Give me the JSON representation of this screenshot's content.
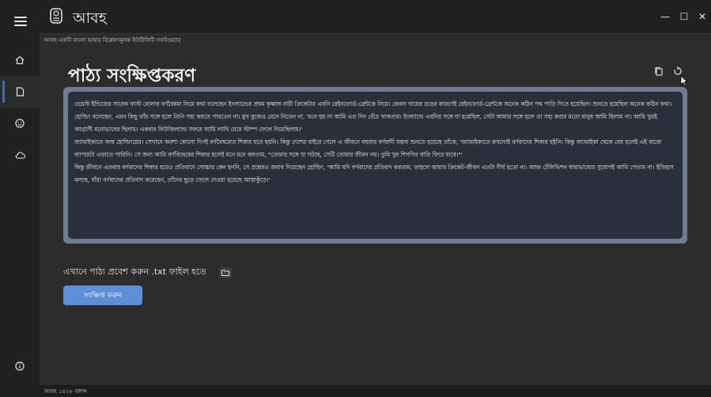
{
  "window": {
    "title": "আবহ",
    "minimize_glyph": "—",
    "maximize_glyph": "☐",
    "close_glyph": "✕"
  },
  "sidebar": {
    "items": [
      {
        "icon": "home-icon"
      },
      {
        "icon": "document-icon",
        "active": true
      },
      {
        "icon": "smile-icon"
      },
      {
        "icon": "cloud-icon"
      },
      {
        "icon": "info-icon"
      }
    ]
  },
  "header": {
    "tagline": "আবহ একটি বাংলা ভাষার বিশ্লেষণমূলক ইউটিলিটি সফটওয়্যার"
  },
  "main": {
    "page_title": "পাঠ্য সংক্ষিপ্তকরণ",
    "text_paragraphs": [
      "ওয়েস্ট ইন্ডিজের সাবেক ফাস্ট বোলার বর্ণবৈষম্য নিয়ে কথা বলেছেন ইংল্যান্ডের প্রথম কৃষ্ণাঙ্গ নারী ক্রিকেটার এবনি রেইনফোর্ড-ব্রেন্টকে নিয়ে। কেবল গায়ের রঙের কারণেই রেইনফোর্ড-ব্রেন্টকে অনেক কঠিন পথ পাড়ি দিতে হয়েছিল। শুনতে হয়েছিল অনেক কঠিন কথা। হোল্ডিং বলেছেন, এমন কিছু তাঁর সঙ্গে হলে তিনি সহ্য করতে পারতেন না। মুখ বুজেও মেনে নিতেন না, 'মনে হয় না আমি এত দিন বেঁচে থাকতাম। ইংল্যান্ডে এবনির সঙ্গে যা হয়েছিল, সেটা আমার সঙ্গে হলে তা সহ্য করার মতো মানুষ আমি ছিলাম না। আমি খুবই আগ্রাসী মনোভাবের ছিলাম। একবার নিউজিল্যান্ড সফরে আমি লাথি মেরে স্টাম্প ফেলে দিয়েছিলাম।'",
      "জ্যামাইকাতে জন্ম হোল্ডিংয়ের। সেখানে অবশ্য কোনো দিনই বর্ণবৈষম্যের শিকার হতে হয়নি। কিন্তু দেশের বাইরে গেলে এ জীবনে বহুবার বর্ণবাদী মন্তব্য শুনতে হয়েছে তাঁকে, 'জ্যামাইকাতে কখনোই বর্ণবাদের শিকার হইনি। কিন্তু জ্যামাইকা থেকে বের হলেই এই বাজে ব্যাপারটা এড়াতে পারিনি। সে জন্য আমি বর্ণবিদ্বেষের শিকার হলেই মনে মনে বলতাম, \"তোমার সঙ্গে যা ঘটছে, সেটি তোমার জীবন নয়। তুমি খুব শিগগির বাড়ি ফিরে যাবে।\"'",
      "কিন্তু জীবনে এতবার বর্ণবাদের শিকার হয়েও প্রতিবাদে সোচ্চার কেন হননি, সে প্রশ্নেরও জবাব দিয়েছেন হোল্ডিং, 'আমি যদি বর্ণবাদের প্রতিবাদ করতাম, তাহলে আমার ক্রিকেট-জীবন এতটা দীর্ঘ হতো না। আজ টেলিভিশন ধারাভাষ্যের সুযোগই আমি পেতাম না। ইতিহাস বলছে, যাঁরা বর্ণবাদের প্রতিবাদ করেছেন, তাঁদের ছুড়ে ফেলে দেওয়া হয়েছে আস্তাকুঁড়ে।'"
    ],
    "file_label": "এখানে পাঠ্য প্রবেশ করুন .txt ফাইল হতে",
    "summarize_label": "সংক্ষিপ্ত করুন"
  },
  "status": {
    "text": "আবহ ১৪২৮ বঙ্গাব্দ"
  },
  "colors": {
    "accent": "#5b8fd6",
    "text_frame": "#6f7d92",
    "text_bg": "#2a3039"
  }
}
